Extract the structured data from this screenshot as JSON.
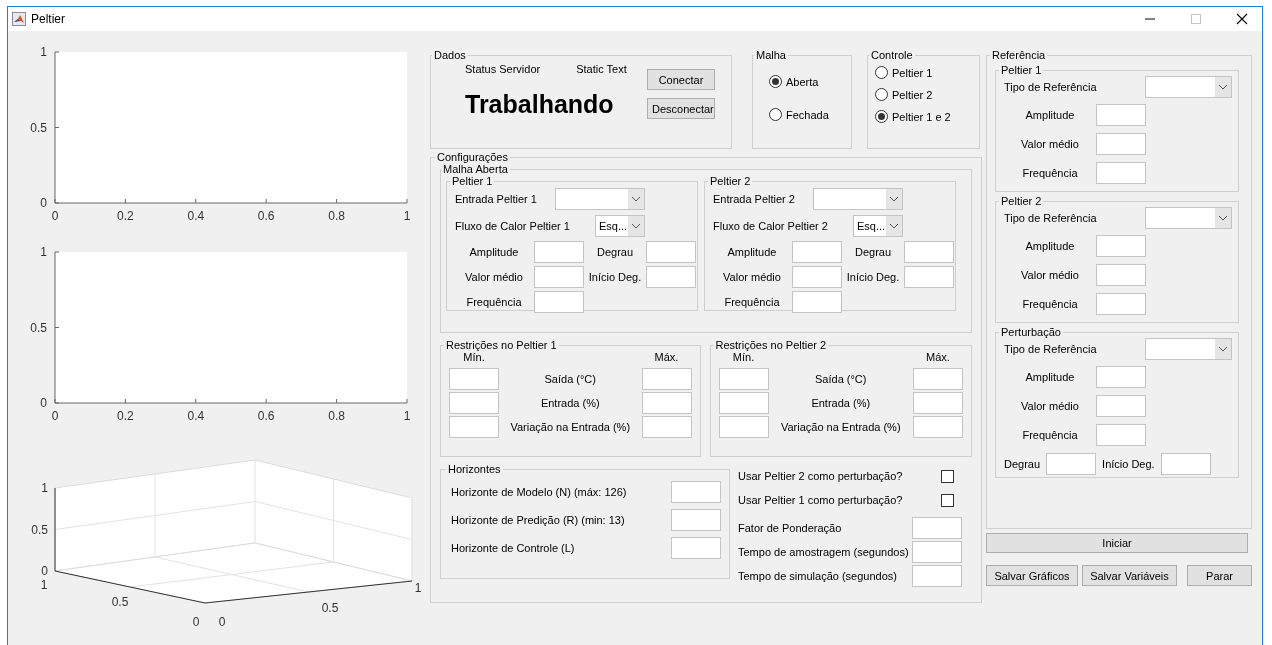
{
  "window": {
    "title": "Peltier"
  },
  "charts": [
    {
      "chart_data": {
        "type": "line",
        "xlim": [
          0,
          1
        ],
        "ylim": [
          0,
          1
        ],
        "xticks": [
          0,
          0.2,
          0.4,
          0.6,
          0.8,
          1
        ],
        "yticks": [
          0,
          0.5,
          1
        ]
      }
    },
    {
      "chart_data": {
        "type": "line",
        "xlim": [
          0,
          1
        ],
        "ylim": [
          0,
          1
        ],
        "xticks": [
          0,
          0.2,
          0.4,
          0.6,
          0.8,
          1
        ],
        "yticks": [
          0,
          0.5,
          1
        ]
      }
    }
  ],
  "axes_3d": {
    "z_ticks": [
      "1",
      "0.5",
      "0"
    ],
    "y_ticks": [
      "1",
      "0.5",
      "0"
    ],
    "x_ticks": [
      "0",
      "0.5",
      "1"
    ]
  },
  "dados": {
    "title": "Dados",
    "status_label": "Status Servidor",
    "static_text": "Static Text",
    "status": "Trabalhando",
    "buttons": [
      "Conectar",
      "Desconectar"
    ]
  },
  "malha": {
    "title": "Malha",
    "options": [
      {
        "label": "Aberta",
        "selected": true
      },
      {
        "label": "Fechada",
        "selected": false
      }
    ]
  },
  "controle": {
    "title": "Controle",
    "options": [
      {
        "label": "Peltier 1",
        "selected": false
      },
      {
        "label": "Peltier 2",
        "selected": false
      },
      {
        "label": "Peltier 1 e 2",
        "selected": true
      }
    ]
  },
  "configuracoes": {
    "title": "Configurações",
    "malha_aberta": {
      "title": "Malha Aberta",
      "peltiers": [
        {
          "title": "Peltier 1",
          "entrada": "Entrada Peltier 1",
          "fluxo": "Fluxo de Calor Peltier 1",
          "fluxo_value": "Esq...",
          "amplitude": "Amplitude",
          "degrau": "Degrau",
          "valor_medio": "Valor médio",
          "inicio": "Início Deg.",
          "frequencia": "Frequência"
        },
        {
          "title": "Peltier 2",
          "entrada": "Entrada Peltier 2",
          "fluxo": "Fluxo de Calor Peltier 2",
          "fluxo_value": "Esq...",
          "amplitude": "Amplitude",
          "degrau": "Degrau",
          "valor_medio": "Valor médio",
          "inicio": "Início Deg.",
          "frequencia": "Frequência"
        }
      ]
    },
    "restricoes": [
      {
        "title": "Restrições no Peltier 1",
        "min": "Mín.",
        "max": "Máx.",
        "rows": [
          "Saída (°C)",
          "Entrada (%)",
          "Variação na Entrada (%)"
        ]
      },
      {
        "title": "Restrições no Peltier 2",
        "min": "Mín.",
        "max": "Máx.",
        "rows": [
          "Saída (°C)",
          "Entrada (%)",
          "Variação na Entrada (%)"
        ]
      }
    ],
    "horizontes": {
      "title": "Horizontes",
      "rows": [
        "Horizonte de Modelo (N) (máx: 126)",
        "Horizonte de Predição (R) (min: 13)",
        "Horizonte de Controle (L)"
      ]
    },
    "checks": [
      {
        "label": "Usar Peltier 2 como perturbação?",
        "checked": false
      },
      {
        "label": "Usar Peltier 1 como perturbação?",
        "checked": false
      }
    ],
    "fields": [
      "Fator de Ponderação",
      "Tempo de amostragem (segundos)",
      "Tempo de simulação (segundos)"
    ]
  },
  "referencia": {
    "title": "Referência",
    "groups": [
      {
        "title": "Peltier 1",
        "tipo": "Tipo de Referência",
        "fields": [
          "Amplitude",
          "Valor médio",
          "Frequência"
        ]
      },
      {
        "title": "Peltier 2",
        "tipo": "Tipo de Referência",
        "fields": [
          "Amplitude",
          "Valor médio",
          "Frequência"
        ]
      },
      {
        "title": "Perturbação",
        "tipo": "Tipo de Referência",
        "fields": [
          "Amplitude",
          "Valor médio",
          "Frequência"
        ],
        "step": [
          "Degrau",
          "Início Deg."
        ]
      }
    ]
  },
  "iniciar": "Iniciar",
  "buttons": [
    "Salvar Gráficos",
    "Salvar Variáveis",
    "Parar"
  ]
}
